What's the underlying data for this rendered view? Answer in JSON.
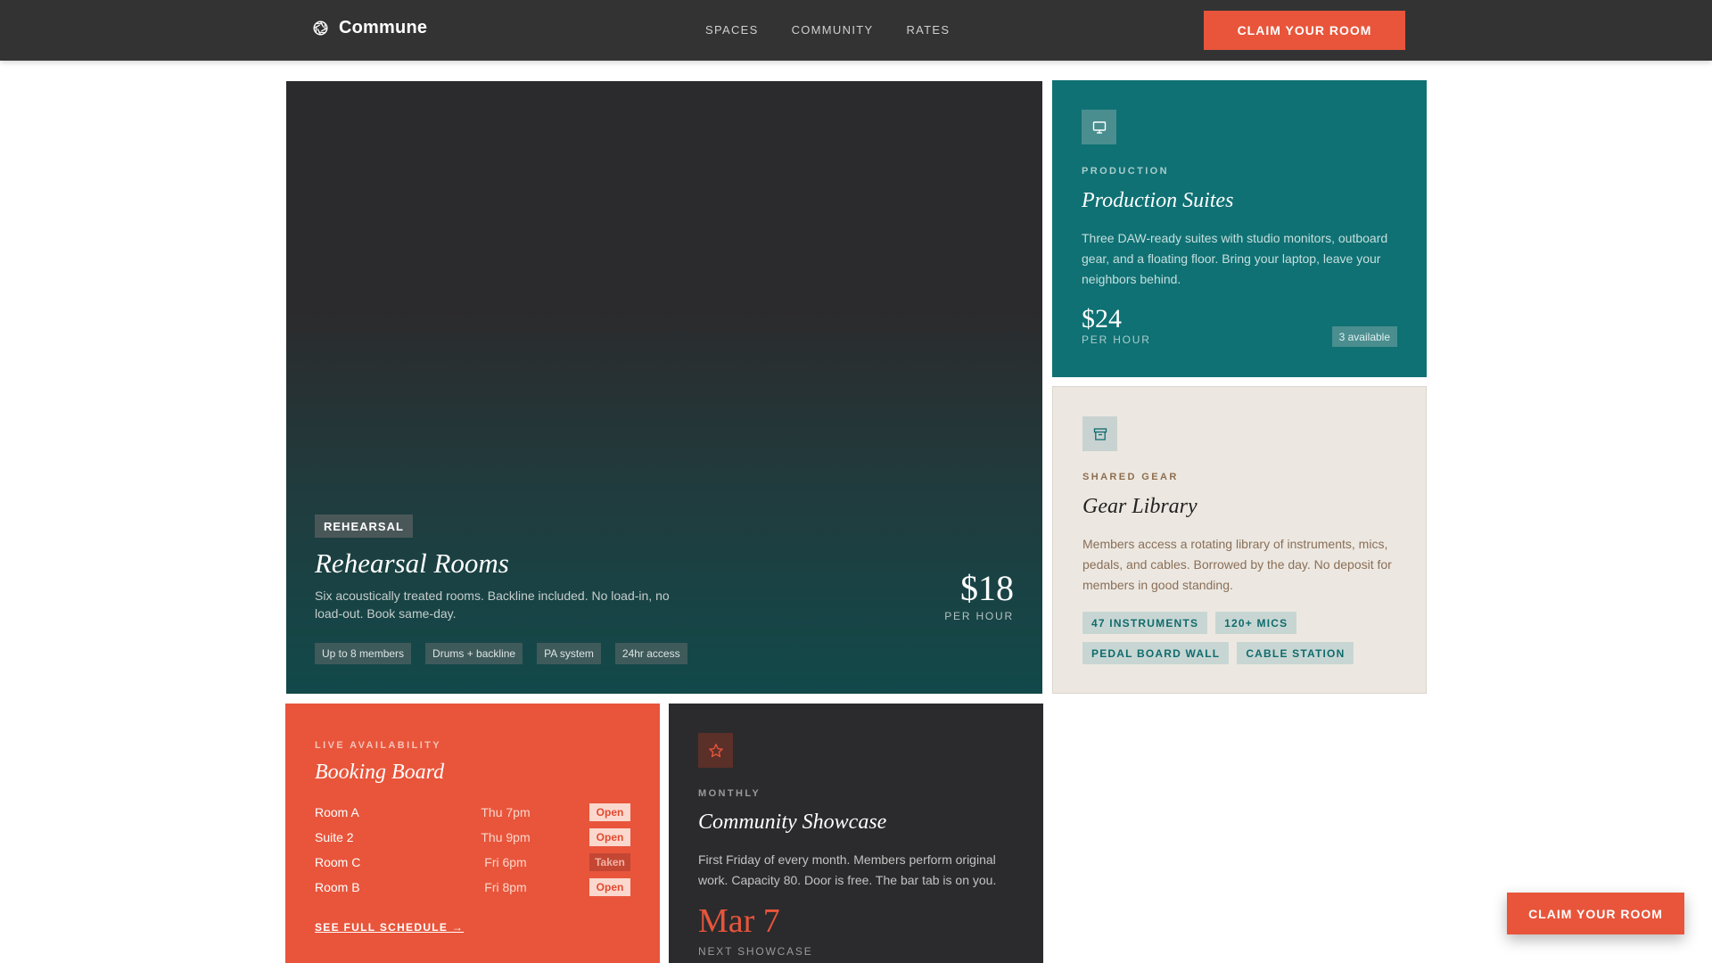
{
  "header": {
    "brand_name": "Commune",
    "brand_icon": "aperture-icon",
    "nav": [
      "SPACES",
      "COMMUNITY",
      "RATES"
    ],
    "cta_label": "CLAIM YOUR ROOM"
  },
  "hero": {
    "badge": "REHEARSAL",
    "title": "Rehearsal Rooms",
    "description": "Six acoustically treated rooms. Backline included. No load-in, no load-out. Book same-day.",
    "price": "$18",
    "price_unit": "PER HOUR",
    "tags": [
      "Up to 8 members",
      "Drums + backline",
      "PA system",
      "24hr access"
    ]
  },
  "production": {
    "icon": "monitor-icon",
    "eyebrow": "PRODUCTION",
    "title": "Production Suites",
    "description": "Three DAW-ready suites with studio monitors, outboard gear, and a floating floor. Bring your laptop, leave your neighbors behind.",
    "price": "$24",
    "price_unit": "PER HOUR",
    "availability": "3 available"
  },
  "gear": {
    "icon": "archive-icon",
    "eyebrow": "SHARED GEAR",
    "title": "Gear Library",
    "description": "Members access a rotating library of instruments, mics, pedals, and cables. Borrowed by the day. No deposit for members in good standing.",
    "chips": [
      "47 INSTRUMENTS",
      "120+ MICS",
      "PEDAL BOARD WALL",
      "CABLE STATION"
    ]
  },
  "booking": {
    "eyebrow": "LIVE AVAILABILITY",
    "title": "Booking Board",
    "rows": [
      {
        "room": "Room A",
        "time": "Thu 7pm",
        "status": "Open"
      },
      {
        "room": "Suite 2",
        "time": "Thu 9pm",
        "status": "Open"
      },
      {
        "room": "Room C",
        "time": "Fri 6pm",
        "status": "Taken"
      },
      {
        "room": "Room B",
        "time": "Fri 8pm",
        "status": "Open"
      }
    ],
    "link_label": "SEE FULL SCHEDULE →"
  },
  "showcase": {
    "icon": "star-icon",
    "eyebrow": "MONTHLY",
    "title": "Community Showcase",
    "description": "First Friday of every month. Members perform original work. Capacity 80. Door is free. The bar tab is on you.",
    "date": "Mar 7",
    "date_label": "NEXT SHOWCASE"
  },
  "floating_cta": {
    "label": "CLAIM YOUR ROOM"
  },
  "colors": {
    "accent": "#e8553b",
    "teal": "#0f7173",
    "dark": "#2b2b2d",
    "header": "#333334",
    "cream": "#ece8e1"
  }
}
